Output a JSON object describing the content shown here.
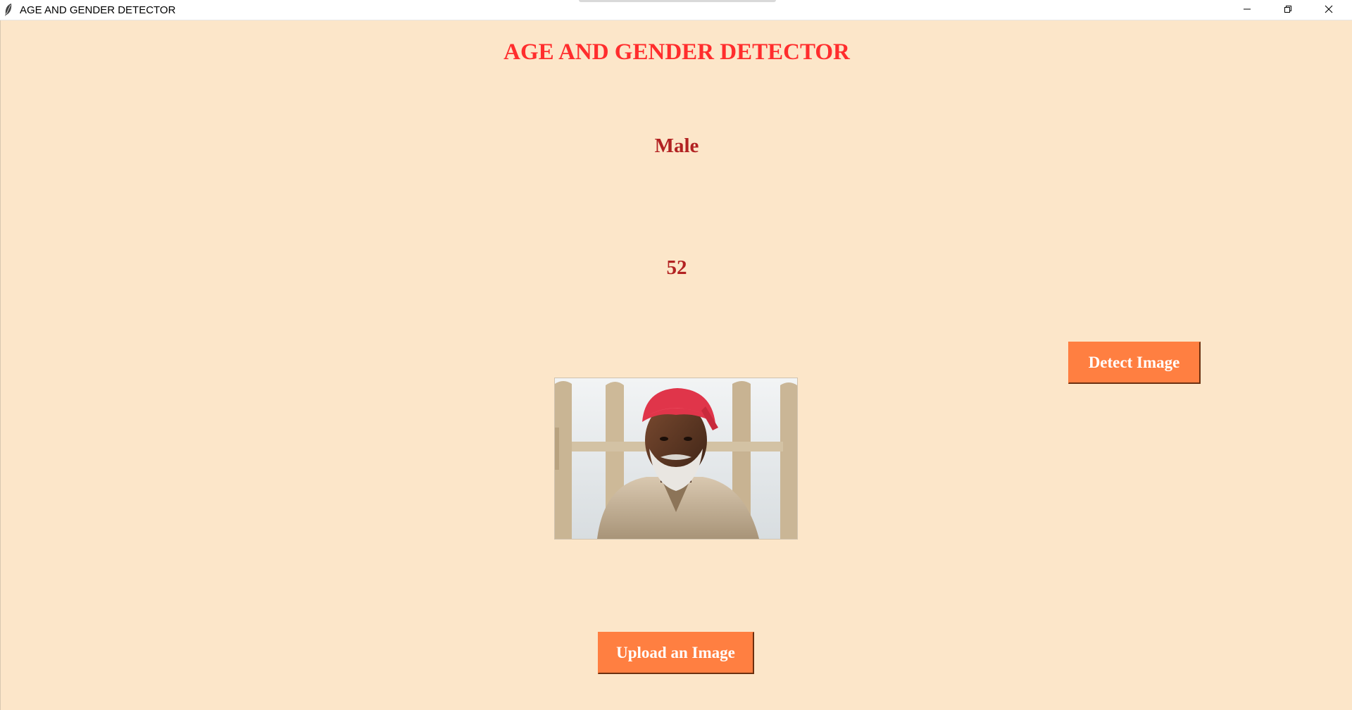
{
  "window": {
    "title": "AGE AND GENDER DETECTOR",
    "app_icon": "feather-icon",
    "controls": [
      "minimize-icon",
      "restore-icon",
      "close-icon"
    ]
  },
  "main": {
    "heading": "AGE AND GENDER DETECTOR",
    "gender_result": "Male",
    "age_result": "52",
    "detect_button_label": "Detect Image",
    "upload_button_label": "Upload an Image",
    "photo_description_icon": "portrait-photo"
  },
  "colors": {
    "background": "#fce6c9",
    "heading": "#ff2d2d",
    "result_text": "#b22222",
    "button_bg": "#ff7f41",
    "button_text": "#ffffff"
  }
}
